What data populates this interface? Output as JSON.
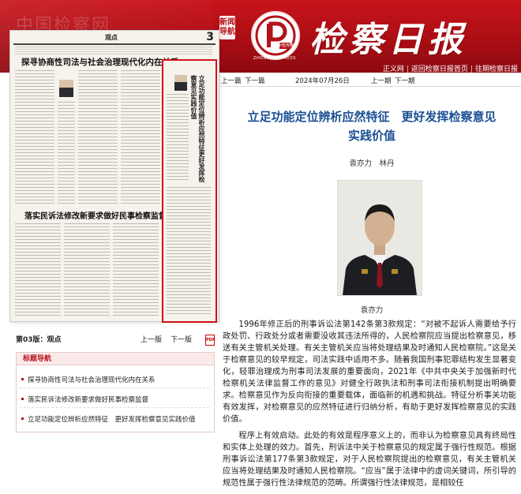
{
  "header": {
    "background_title": "中国检察网",
    "side_tag": "新闻导航",
    "logo_caption": "ZHONGJIAN PRESS",
    "logo_badge": "中检传媒",
    "paper_title": "检察日报",
    "links": [
      "正义网",
      "返回检察日报首页",
      "往期检察日报"
    ],
    "colors": {
      "brand_red": "#b3141b",
      "title_blue": "#1a4f94"
    }
  },
  "newspaper": {
    "section": "观点",
    "page_number": "3",
    "headline1": "探寻协商性司法与社会治理现代化内在关系",
    "headline2": "落实民诉法修改新要求做好民事检察监督",
    "highlight_vertical_title": "立足功能定位辨析应然特征更好发挥检察意见实践价值"
  },
  "page_row": {
    "current": "第03版：观点",
    "prev": "上一版",
    "next": "下一版"
  },
  "nav": {
    "title": "标题导航",
    "items": [
      "探寻协商性司法与社会治理现代化内在关系",
      "落实民诉法修改新要求做好民事检察监督",
      "立足功能定位辨析应然特征　更好发挥检察意见实践价值"
    ]
  },
  "topnav": {
    "prev_article": "上一篇",
    "next_article": "下一篇",
    "date": "2024年07月26日",
    "prev_issue": "上一期",
    "next_issue": "下一期"
  },
  "article": {
    "title_line1": "立足功能定位辨析应然特征　更好发挥检察意见",
    "title_line2": "实践价值",
    "authors": "袁亦力　林丹",
    "photo_caption": "袁亦力",
    "paragraphs": [
      "1996年修正后的刑事诉讼法第142条第3款规定：“对被不起诉人需要给予行政处罚、行政处分或者需要没收其违法所得的，人民检察院应当提出检察意见，移送有关主管机关处理。有关主管机关应当将处理结果及时通知人民检察院。”这是关于检察意见的较早规定，司法实践中适用不多。随着我国刑事犯罪结构发生显著变化，轻罪治理成为刑事司法发展的重要面向，2021年《中共中央关于加强新时代检察机关法律监督工作的意见》对健全行政执法和刑事司法衔接机制提出明确要求。检察意见作为反向衔接的重要载体，面临新的机遇和挑战。特征分析事关功能有效发挥，对检察意见的应然特征进行归纳分析，有助于更好发挥检察意见的实践价值。",
      "程序上有效启动。此处的有效是程序意义上的，而非认为检察意见具有终局性和实体上处理的效力。首先，刑诉法中关于检察意见的规定属于强行性规范。根据刑事诉讼法第177条第3款规定，对于人民检察院提出的检察意见，有关主管机关应当将处理结果及时通知人民检察院。“应当”属于法律中的虚词关键词，所引导的规范性属于强行性法律规范的范畴。所谓强行性法律规范，是相较任"
    ]
  }
}
